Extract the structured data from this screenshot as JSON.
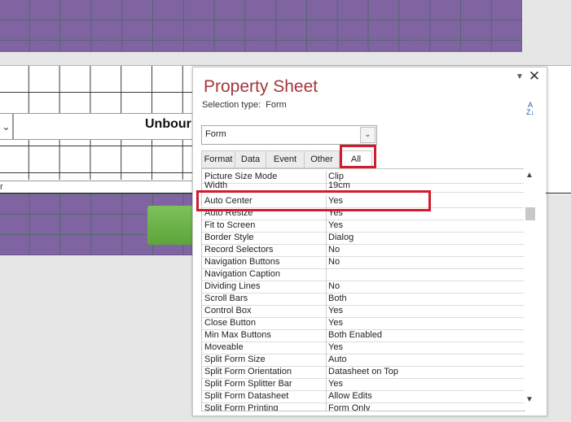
{
  "background_form": {
    "combo_arrow": "⌄",
    "unbound_label": "Unbour",
    "footer_label": "r"
  },
  "property_sheet": {
    "title": "Property Sheet",
    "selection_type_label": "Selection type:",
    "selection_type_value": "Form",
    "object_select_value": "Form",
    "tabs": [
      "Format",
      "Data",
      "Event",
      "Other",
      "All"
    ],
    "active_tab": "All",
    "properties": [
      {
        "name": "Picture Size Mode",
        "value": "Clip"
      },
      {
        "name": "Width",
        "value": "19cm"
      },
      {
        "name": "Auto Center",
        "value": "Yes"
      },
      {
        "name": "Auto Resize",
        "value": "Yes"
      },
      {
        "name": "Fit to Screen",
        "value": "Yes"
      },
      {
        "name": "Border Style",
        "value": "Dialog"
      },
      {
        "name": "Record Selectors",
        "value": "No"
      },
      {
        "name": "Navigation Buttons",
        "value": "No"
      },
      {
        "name": "Navigation Caption",
        "value": ""
      },
      {
        "name": "Dividing Lines",
        "value": "No"
      },
      {
        "name": "Scroll Bars",
        "value": "Both"
      },
      {
        "name": "Control Box",
        "value": "Yes"
      },
      {
        "name": "Close Button",
        "value": "Yes"
      },
      {
        "name": "Min Max Buttons",
        "value": "Both Enabled"
      },
      {
        "name": "Moveable",
        "value": "Yes"
      },
      {
        "name": "Split Form Size",
        "value": "Auto"
      },
      {
        "name": "Split Form Orientation",
        "value": "Datasheet on Top"
      },
      {
        "name": "Split Form Splitter Bar",
        "value": "Yes"
      },
      {
        "name": "Split Form Datasheet",
        "value": "Allow Edits"
      },
      {
        "name": "Split Form Printing",
        "value": "Form Only"
      }
    ],
    "highlighted_property": "Auto Center"
  },
  "colors": {
    "title_red": "#a4373a",
    "highlight_red": "#d01c2c",
    "form_purple": "#8064a2",
    "button_green": "#6cb34a"
  }
}
